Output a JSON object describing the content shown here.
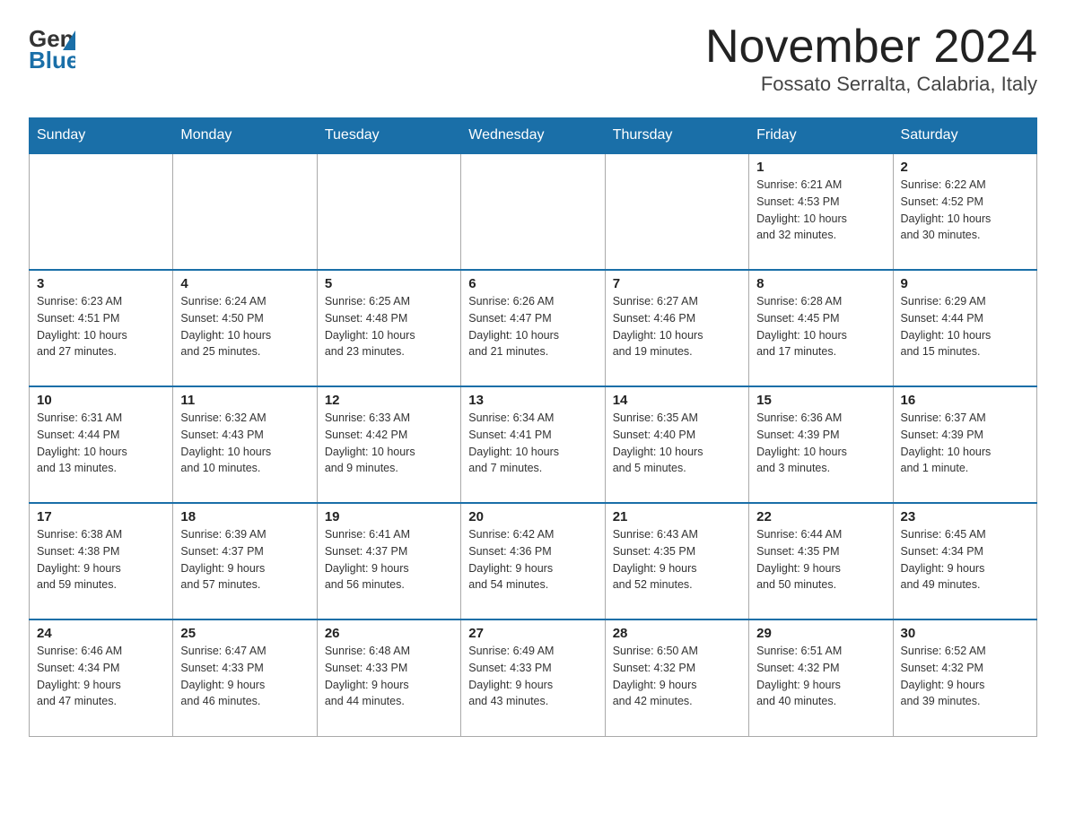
{
  "logo": {
    "general": "General",
    "blue": "Blue"
  },
  "title": "November 2024",
  "location": "Fossato Serralta, Calabria, Italy",
  "days_of_week": [
    "Sunday",
    "Monday",
    "Tuesday",
    "Wednesday",
    "Thursday",
    "Friday",
    "Saturday"
  ],
  "weeks": [
    [
      {
        "day": "",
        "info": ""
      },
      {
        "day": "",
        "info": ""
      },
      {
        "day": "",
        "info": ""
      },
      {
        "day": "",
        "info": ""
      },
      {
        "day": "",
        "info": ""
      },
      {
        "day": "1",
        "info": "Sunrise: 6:21 AM\nSunset: 4:53 PM\nDaylight: 10 hours\nand 32 minutes."
      },
      {
        "day": "2",
        "info": "Sunrise: 6:22 AM\nSunset: 4:52 PM\nDaylight: 10 hours\nand 30 minutes."
      }
    ],
    [
      {
        "day": "3",
        "info": "Sunrise: 6:23 AM\nSunset: 4:51 PM\nDaylight: 10 hours\nand 27 minutes."
      },
      {
        "day": "4",
        "info": "Sunrise: 6:24 AM\nSunset: 4:50 PM\nDaylight: 10 hours\nand 25 minutes."
      },
      {
        "day": "5",
        "info": "Sunrise: 6:25 AM\nSunset: 4:48 PM\nDaylight: 10 hours\nand 23 minutes."
      },
      {
        "day": "6",
        "info": "Sunrise: 6:26 AM\nSunset: 4:47 PM\nDaylight: 10 hours\nand 21 minutes."
      },
      {
        "day": "7",
        "info": "Sunrise: 6:27 AM\nSunset: 4:46 PM\nDaylight: 10 hours\nand 19 minutes."
      },
      {
        "day": "8",
        "info": "Sunrise: 6:28 AM\nSunset: 4:45 PM\nDaylight: 10 hours\nand 17 minutes."
      },
      {
        "day": "9",
        "info": "Sunrise: 6:29 AM\nSunset: 4:44 PM\nDaylight: 10 hours\nand 15 minutes."
      }
    ],
    [
      {
        "day": "10",
        "info": "Sunrise: 6:31 AM\nSunset: 4:44 PM\nDaylight: 10 hours\nand 13 minutes."
      },
      {
        "day": "11",
        "info": "Sunrise: 6:32 AM\nSunset: 4:43 PM\nDaylight: 10 hours\nand 10 minutes."
      },
      {
        "day": "12",
        "info": "Sunrise: 6:33 AM\nSunset: 4:42 PM\nDaylight: 10 hours\nand 9 minutes."
      },
      {
        "day": "13",
        "info": "Sunrise: 6:34 AM\nSunset: 4:41 PM\nDaylight: 10 hours\nand 7 minutes."
      },
      {
        "day": "14",
        "info": "Sunrise: 6:35 AM\nSunset: 4:40 PM\nDaylight: 10 hours\nand 5 minutes."
      },
      {
        "day": "15",
        "info": "Sunrise: 6:36 AM\nSunset: 4:39 PM\nDaylight: 10 hours\nand 3 minutes."
      },
      {
        "day": "16",
        "info": "Sunrise: 6:37 AM\nSunset: 4:39 PM\nDaylight: 10 hours\nand 1 minute."
      }
    ],
    [
      {
        "day": "17",
        "info": "Sunrise: 6:38 AM\nSunset: 4:38 PM\nDaylight: 9 hours\nand 59 minutes."
      },
      {
        "day": "18",
        "info": "Sunrise: 6:39 AM\nSunset: 4:37 PM\nDaylight: 9 hours\nand 57 minutes."
      },
      {
        "day": "19",
        "info": "Sunrise: 6:41 AM\nSunset: 4:37 PM\nDaylight: 9 hours\nand 56 minutes."
      },
      {
        "day": "20",
        "info": "Sunrise: 6:42 AM\nSunset: 4:36 PM\nDaylight: 9 hours\nand 54 minutes."
      },
      {
        "day": "21",
        "info": "Sunrise: 6:43 AM\nSunset: 4:35 PM\nDaylight: 9 hours\nand 52 minutes."
      },
      {
        "day": "22",
        "info": "Sunrise: 6:44 AM\nSunset: 4:35 PM\nDaylight: 9 hours\nand 50 minutes."
      },
      {
        "day": "23",
        "info": "Sunrise: 6:45 AM\nSunset: 4:34 PM\nDaylight: 9 hours\nand 49 minutes."
      }
    ],
    [
      {
        "day": "24",
        "info": "Sunrise: 6:46 AM\nSunset: 4:34 PM\nDaylight: 9 hours\nand 47 minutes."
      },
      {
        "day": "25",
        "info": "Sunrise: 6:47 AM\nSunset: 4:33 PM\nDaylight: 9 hours\nand 46 minutes."
      },
      {
        "day": "26",
        "info": "Sunrise: 6:48 AM\nSunset: 4:33 PM\nDaylight: 9 hours\nand 44 minutes."
      },
      {
        "day": "27",
        "info": "Sunrise: 6:49 AM\nSunset: 4:33 PM\nDaylight: 9 hours\nand 43 minutes."
      },
      {
        "day": "28",
        "info": "Sunrise: 6:50 AM\nSunset: 4:32 PM\nDaylight: 9 hours\nand 42 minutes."
      },
      {
        "day": "29",
        "info": "Sunrise: 6:51 AM\nSunset: 4:32 PM\nDaylight: 9 hours\nand 40 minutes."
      },
      {
        "day": "30",
        "info": "Sunrise: 6:52 AM\nSunset: 4:32 PM\nDaylight: 9 hours\nand 39 minutes."
      }
    ]
  ]
}
